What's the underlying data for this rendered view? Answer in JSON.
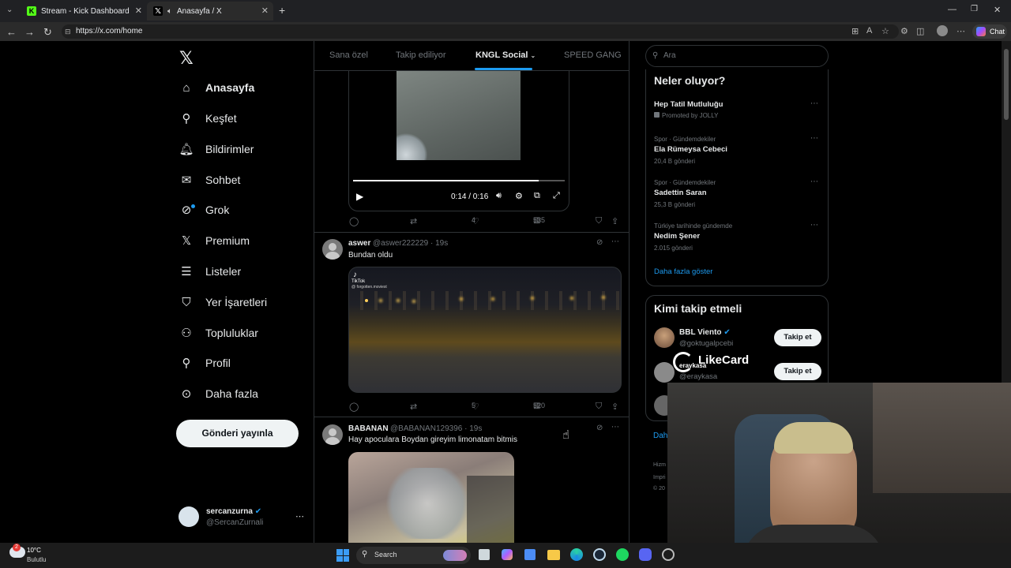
{
  "browser": {
    "tabs": [
      {
        "title": "Stream - Kick Dashboard",
        "favicon": "kick-icon"
      },
      {
        "title": "Anasayfa / X",
        "favicon": "x-icon"
      }
    ],
    "url": "https://x.com/home",
    "chat_label": "Chat"
  },
  "sidebar": {
    "items": [
      {
        "label": "Anasayfa",
        "icon": "home-icon"
      },
      {
        "label": "Keşfet",
        "icon": "search-icon"
      },
      {
        "label": "Bildirimler",
        "icon": "bell-icon"
      },
      {
        "label": "Sohbet",
        "icon": "mail-icon"
      },
      {
        "label": "Grok",
        "icon": "grok-icon"
      },
      {
        "label": "Premium",
        "icon": "x-icon"
      },
      {
        "label": "Listeler",
        "icon": "list-icon"
      },
      {
        "label": "Yer İşaretleri",
        "icon": "bookmark-icon"
      },
      {
        "label": "Topluluklar",
        "icon": "community-icon"
      },
      {
        "label": "Profil",
        "icon": "person-icon"
      },
      {
        "label": "Daha fazla",
        "icon": "more-circle-icon"
      }
    ],
    "post_button": "Gönderi yayınla",
    "account": {
      "name": "sercanzurna",
      "handle": "@SercanZurnali"
    }
  },
  "feed": {
    "tabs": [
      "Sana özel",
      "Takip ediliyor",
      "KNGL Social",
      "SPEED GANG"
    ],
    "active_tab": "KNGL Social",
    "video_player": {
      "time": "0:14 / 0:16",
      "progress": 0.875
    },
    "first_post_stats": {
      "likes": "4",
      "views": "535"
    },
    "posts": [
      {
        "name": "aswer",
        "handle": "@aswer222229",
        "time": "· 19s",
        "text": "Bundan oldu",
        "likes": "5",
        "views": "520",
        "media_watermark": "TikTok",
        "media_credit": "@ forgotten.moviest"
      },
      {
        "name": "BABANAN",
        "handle": "@BABANAN129396",
        "time": "· 19s",
        "text": "Hay apoculara Boydan gireyim limonatam bitmis"
      }
    ]
  },
  "right": {
    "search_placeholder": "Ara",
    "trends_title": "Neler oluyor?",
    "trends": [
      {
        "meta": "",
        "name": "Hep Tatil Mutluluğu",
        "count": "Promoted by JOLLY"
      },
      {
        "meta": "Spor · Gündemdekiler",
        "name": "Ela Rümeysa Cebeci",
        "count": "20,4 B gönderi"
      },
      {
        "meta": "Spor · Gündemdekiler",
        "name": "Sadettin Saran",
        "count": "25,3 B gönderi"
      },
      {
        "meta": "Türkiye tarihinde gündemde",
        "name": "Nedim Şener",
        "count": "2.015 gönderi"
      }
    ],
    "show_more": "Daha fazla göster",
    "who_to_follow_title": "Kimi takip etmeli",
    "suggestions": [
      {
        "name": "BBL Viento",
        "handle": "@goktugalpcebi",
        "button": "Takip et"
      },
      {
        "name": "",
        "handle": "@eraykasa",
        "button": "Takip et"
      }
    ],
    "overlay_logo": "LikeCard",
    "overlay_user": "eraykasa",
    "footer_partial": [
      "Hizm",
      "Impri",
      "© 20"
    ],
    "cut_link": "Daha"
  },
  "taskbar": {
    "weather_temp": "10°C",
    "weather_desc": "Bulutlu",
    "search_label": "Search",
    "notif_badge": "2"
  },
  "colors": {
    "accent": "#1d9bf0",
    "verified": "#1d9bf0",
    "bg": "#000000",
    "border": "#2f3336"
  }
}
